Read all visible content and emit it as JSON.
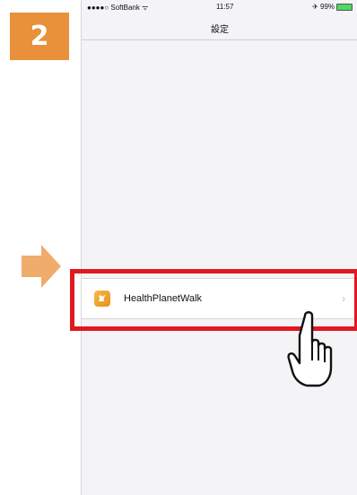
{
  "step_badge": "2",
  "phone": {
    "status_bar": {
      "carrier": "●●●●○ SoftBank ᯤ",
      "time": "11:57",
      "battery": "✈ 99%"
    },
    "nav_title": "設定",
    "settings_row": {
      "label": "HealthPlanetWalk",
      "chevron": "›",
      "icon": "healthplanet-app-icon"
    }
  },
  "colors": {
    "badge": "#e8913a",
    "arrow": "#f0ac6a",
    "highlight": "#e0191f",
    "battery": "#4cd964"
  },
  "icons": {
    "arrow": "right-arrow-icon",
    "pointer": "pointing-hand-icon"
  }
}
